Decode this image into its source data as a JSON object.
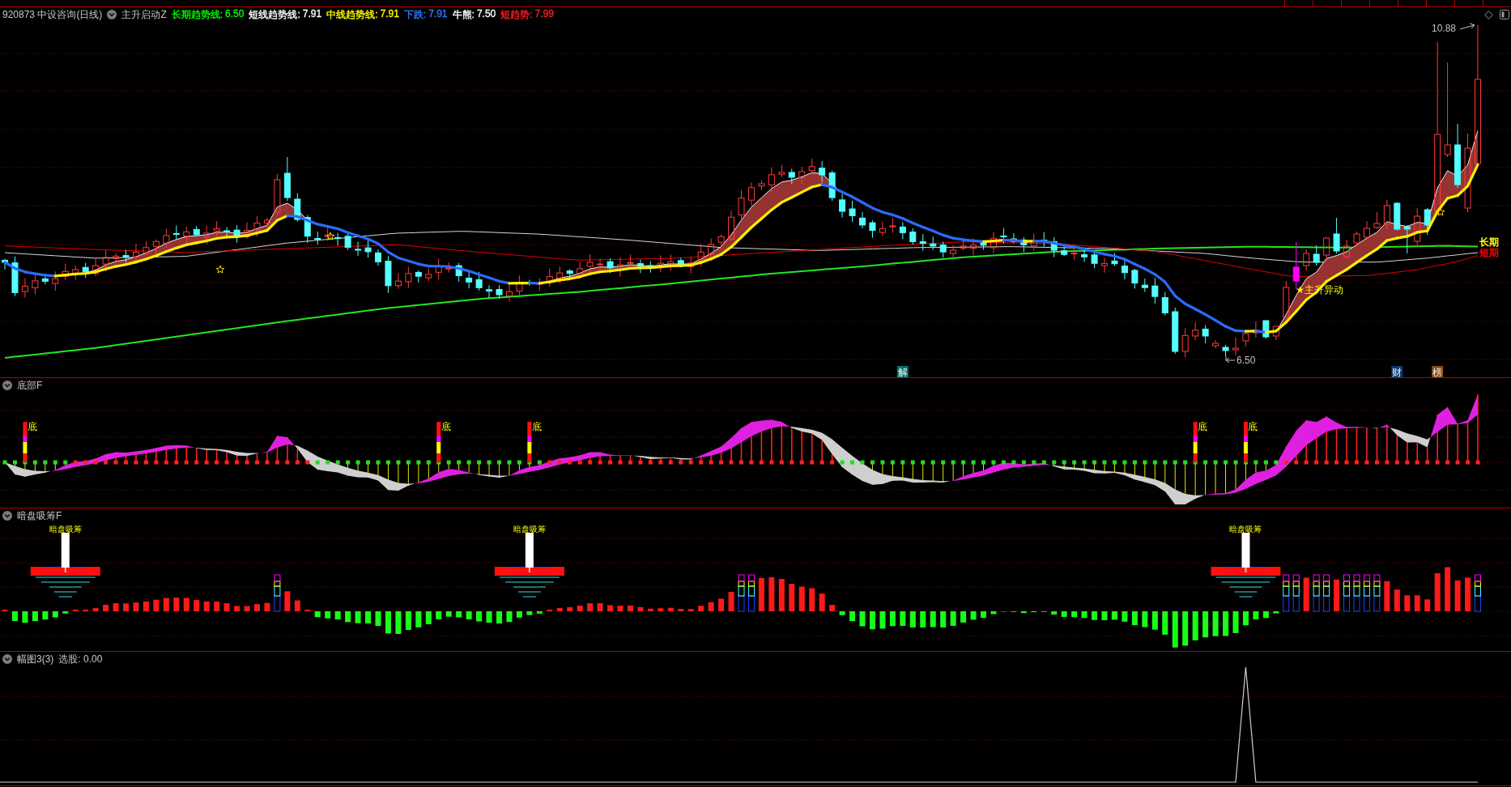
{
  "main_panel": {
    "security": "920873 中设咨询(日线)",
    "indicator": "主升启动Z",
    "legend": [
      {
        "label": "长期趋势线:",
        "value": "6.50",
        "color": "#00ff00"
      },
      {
        "label": "短线趋势线:",
        "value": "7.91",
        "color": "#ffffff"
      },
      {
        "label": "中线趋势线:",
        "value": "7.91",
        "color": "#ffff00"
      },
      {
        "label": "下跌:",
        "value": "7.91",
        "color": "#2e7bff"
      },
      {
        "label": "牛熊:",
        "value": "7.50",
        "color": "#ffffff"
      },
      {
        "label": "短趋势:",
        "value": "7.99",
        "color": "#ff2020"
      }
    ],
    "high_price": "10.88",
    "low_price": "6.50",
    "signal": "★主升异动",
    "line_labels": [
      {
        "text": "长期",
        "color": "#ffff00"
      },
      {
        "text": "短期",
        "color": "#ff0000"
      }
    ],
    "event_badges": [
      {
        "text": "解",
        "color": "#00706a"
      },
      {
        "text": "财",
        "color": "#0a3a70"
      },
      {
        "text": "榜",
        "color": "#8b4a10"
      }
    ]
  },
  "bottom_panel": {
    "title": "底部F",
    "signals": [
      "底",
      "底",
      "底",
      "底",
      "底"
    ]
  },
  "accumulation_panel": {
    "title": "暗盘吸筹F",
    "signals": [
      "暗盘吸筹",
      "暗盘吸筹",
      "暗盘吸筹"
    ]
  },
  "screen_panel": {
    "title": "幅图3(3)",
    "reading": "选股: 0.00"
  }
}
